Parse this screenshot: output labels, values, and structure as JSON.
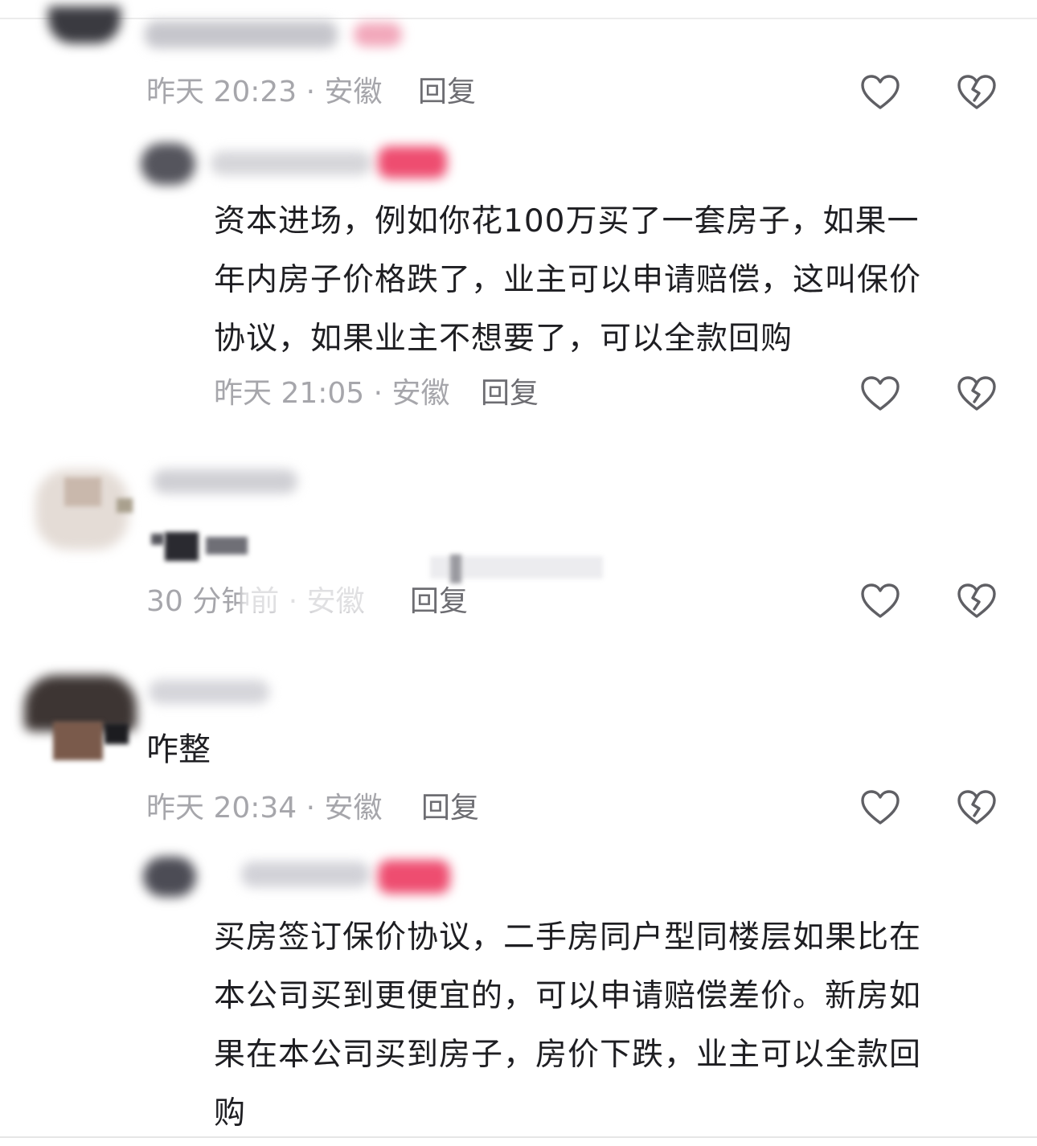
{
  "comments": [
    {
      "meta": "昨天 20:23 · 安徽",
      "reply": "回复"
    },
    {
      "text_lines": [
        "资本进场，例如你花100万买了一套房子，如果一",
        "年内房子价格跌了，业主可以申请赔偿，这叫保价",
        "协议，如果业主不想要了，可以全款回购"
      ],
      "meta": "昨天 21:05 · 安徽",
      "reply": "回复"
    },
    {
      "meta": "30 分钟前 · 安徽",
      "reply": "回复"
    },
    {
      "text": "咋整",
      "meta": "昨天 20:34 · 安徽",
      "reply": "回复"
    },
    {
      "text_lines": [
        "买房签订保价协议，二手房同户型同楼层如果比在",
        "本公司买到更便宜的，可以申请赔偿差价。新房如",
        "果在本公司买到房子，房价下跌，业主可以全款回",
        "购"
      ]
    }
  ],
  "icons": {
    "like": "heart-outline-icon",
    "dislike": "broken-heart-icon"
  },
  "colors": {
    "meta_text": "#a6a6ab",
    "reply_text": "#6d6d72",
    "body_text": "#1e1e22",
    "icon_stroke": "#5f5f64",
    "badge_pink": "#ee4d70"
  }
}
